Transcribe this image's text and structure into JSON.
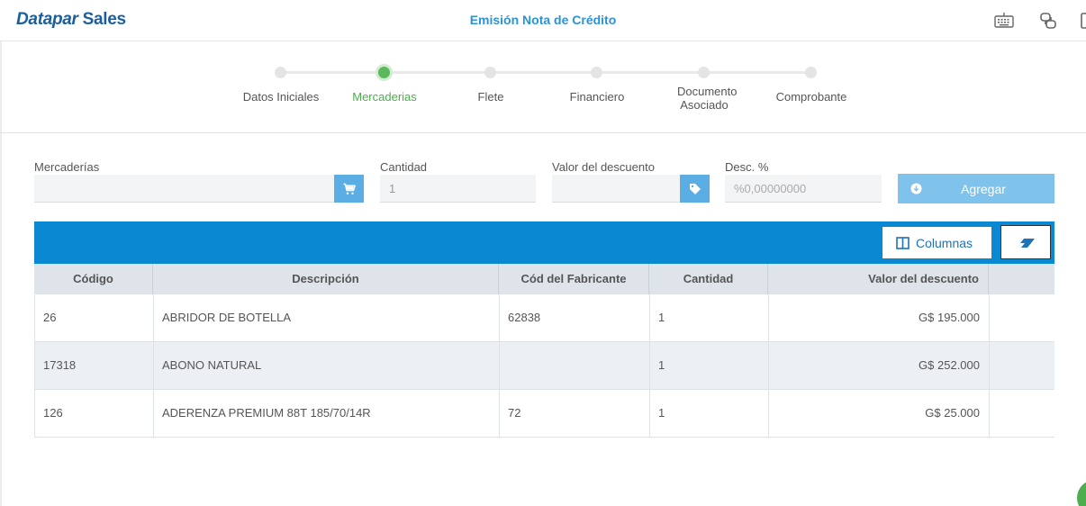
{
  "header": {
    "logo_brand": "Datapar",
    "logo_product": "Sales",
    "title": "Emisión Nota de Crédito",
    "icons": [
      "keyboard-icon",
      "plug-icon",
      "sidebar-icon"
    ]
  },
  "stepper": {
    "steps": [
      {
        "label": "Datos Iniciales",
        "state": "done"
      },
      {
        "label": "Mercaderias",
        "state": "active"
      },
      {
        "label": "Flete",
        "state": "pending"
      },
      {
        "label": "Financiero",
        "state": "pending"
      },
      {
        "label": "Documento Asociado",
        "state": "pending"
      },
      {
        "label": "Comprobante",
        "state": "pending"
      }
    ],
    "active_color": "#5cb85c"
  },
  "form": {
    "mercaderias": {
      "label": "Mercaderías",
      "value": "",
      "icon": "cart-icon"
    },
    "cantidad": {
      "label": "Cantidad",
      "value": "1"
    },
    "valor_descuento": {
      "label": "Valor del descuento",
      "value": "",
      "icon": "tag-icon"
    },
    "desc_pct": {
      "label": "Desc. %",
      "placeholder": "%0,00000000"
    },
    "add_button": "Agregar"
  },
  "table": {
    "toolbar_color": "#0a88d2",
    "columns_button": "Columnas",
    "clear_button_icon": "eraser-icon",
    "headers": [
      "Código",
      "Descripción",
      "Cód del Fabricante",
      "Cantidad",
      "Valor del descuento"
    ],
    "rows": [
      {
        "codigo": "26",
        "descripcion": "ABRIDOR DE BOTELLA",
        "cod_fabricante": "62838",
        "cantidad": "1",
        "valor_descuento": "G$ 195.000"
      },
      {
        "codigo": "17318",
        "descripcion": "ABONO NATURAL",
        "cod_fabricante": "",
        "cantidad": "1",
        "valor_descuento": "G$ 252.000"
      },
      {
        "codigo": "126",
        "descripcion": "ADERENZA PREMIUM 88T 185/70/14R",
        "cod_fabricante": "72",
        "cantidad": "1",
        "valor_descuento": "G$ 25.000"
      }
    ]
  }
}
